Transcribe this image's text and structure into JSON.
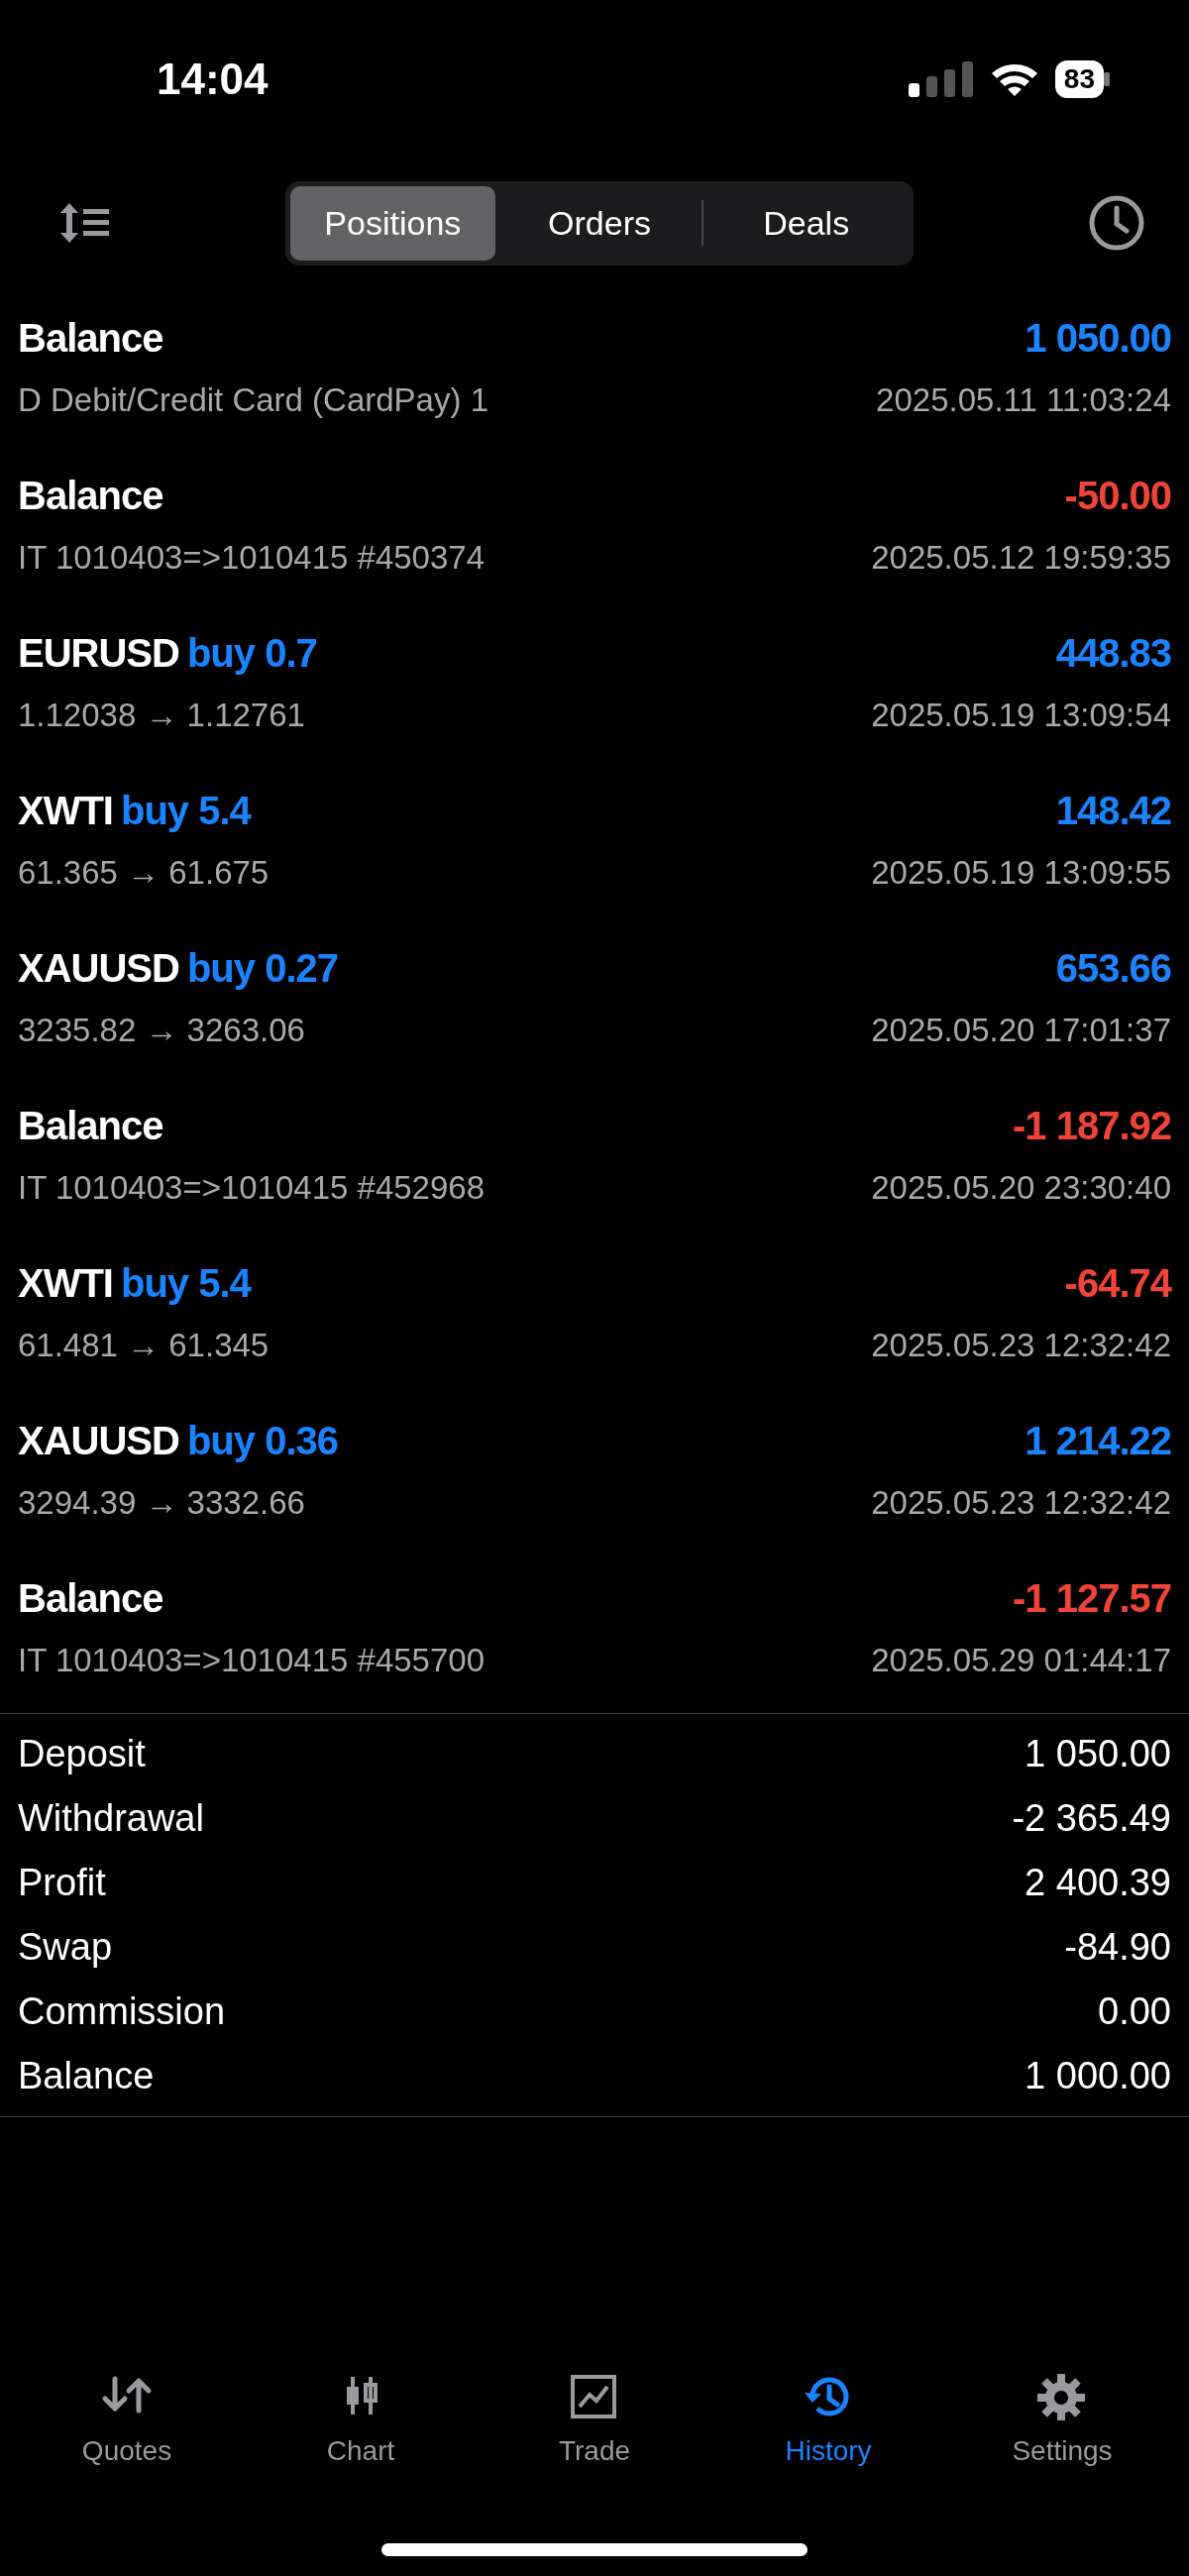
{
  "status_bar": {
    "time": "14:04",
    "battery": "83"
  },
  "segments": [
    {
      "label": "Positions",
      "selected": true
    },
    {
      "label": "Orders",
      "selected": false
    },
    {
      "label": "Deals",
      "selected": false
    }
  ],
  "entries": [
    {
      "symbol": "Balance",
      "detail": "D Debit/Credit Card (CardPay) 1",
      "time": "2025.05.11 11:03:24",
      "amount": "1 050.00",
      "color": "#1a84ff"
    },
    {
      "symbol": "Balance",
      "detail": "IT 1010403=>1010415 #450374",
      "time": "2025.05.12 19:59:35",
      "amount": "-50.00",
      "color": "#f04438"
    },
    {
      "symbol": "EURUSD",
      "action": "buy 0.7",
      "detail": "1.12038 → 1.12761",
      "time": "2025.05.19 13:09:54",
      "amount": "448.83",
      "color": "#1a84ff"
    },
    {
      "symbol": "XWTI",
      "action": "buy 5.4",
      "detail": "61.365 → 61.675",
      "time": "2025.05.19 13:09:55",
      "amount": "148.42",
      "color": "#1a84ff"
    },
    {
      "symbol": "XAUUSD",
      "action": "buy 0.27",
      "detail": "3235.82 → 3263.06",
      "time": "2025.05.20 17:01:37",
      "amount": "653.66",
      "color": "#1a84ff"
    },
    {
      "symbol": "Balance",
      "detail": "IT 1010403=>1010415 #452968",
      "time": "2025.05.20 23:30:40",
      "amount": "-1 187.92",
      "color": "#f04438"
    },
    {
      "symbol": "XWTI",
      "action": "buy 5.4",
      "detail": "61.481 → 61.345",
      "time": "2025.05.23 12:32:42",
      "amount": "-64.74",
      "color": "#f04438"
    },
    {
      "symbol": "XAUUSD",
      "action": "buy 0.36",
      "detail": "3294.39 → 3332.66",
      "time": "2025.05.23 12:32:42",
      "amount": "1 214.22",
      "color": "#1a84ff"
    },
    {
      "symbol": "Balance",
      "detail": "IT 1010403=>1010415 #455700",
      "time": "2025.05.29 01:44:17",
      "amount": "-1 127.57",
      "color": "#f04438"
    }
  ],
  "summary": [
    {
      "label": "Deposit",
      "value": "1 050.00"
    },
    {
      "label": "Withdrawal",
      "value": "-2 365.49"
    },
    {
      "label": "Profit",
      "value": "2 400.39"
    },
    {
      "label": "Swap",
      "value": "-84.90"
    },
    {
      "label": "Commission",
      "value": "0.00"
    },
    {
      "label": "Balance",
      "value": "1 000.00"
    }
  ],
  "tab_bar": [
    {
      "label": "Quotes",
      "kind": "quotes",
      "selected": false
    },
    {
      "label": "Chart",
      "kind": "chart",
      "selected": false
    },
    {
      "label": "Trade",
      "kind": "trade",
      "selected": false
    },
    {
      "label": "History",
      "kind": "history",
      "selected": true
    },
    {
      "label": "Settings",
      "kind": "settings",
      "selected": false
    }
  ]
}
